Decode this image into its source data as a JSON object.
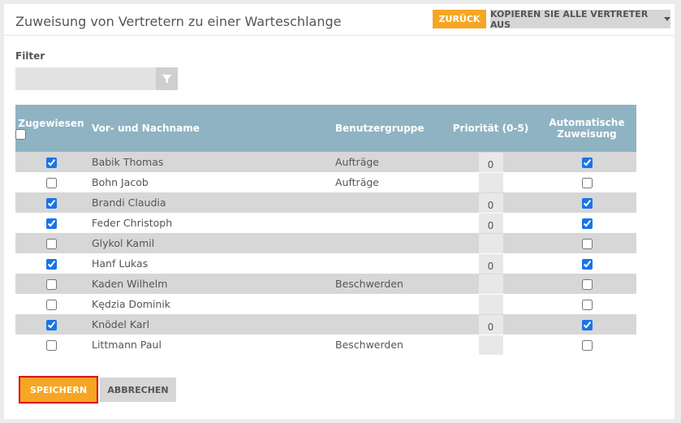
{
  "header": {
    "title": "Zuweisung von Vertretern zu einer Warteschlange",
    "back_label": "ZURÜCK",
    "copy_label": "KOPIEREN SIE ALLE VERTRETER AUS"
  },
  "filter": {
    "label": "Filter",
    "value": "",
    "placeholder": ""
  },
  "table": {
    "columns": [
      "Zugewiesen",
      "Vor- und Nachname",
      "Benutzergruppe",
      "Priorität (0-5)",
      "Automatische Zuweisung"
    ],
    "rows": [
      {
        "assigned": true,
        "name": "Babik Thomas",
        "group": "Aufträge",
        "priority": "0",
        "auto": true
      },
      {
        "assigned": false,
        "name": "Bohn Jacob",
        "group": "Aufträge",
        "priority": "",
        "auto": false
      },
      {
        "assigned": true,
        "name": "Brandi Claudia",
        "group": "",
        "priority": "0",
        "auto": true
      },
      {
        "assigned": true,
        "name": "Feder Christoph",
        "group": "",
        "priority": "0",
        "auto": true
      },
      {
        "assigned": false,
        "name": "Glykol Kamil",
        "group": "",
        "priority": "",
        "auto": false
      },
      {
        "assigned": true,
        "name": "Hanf Lukas",
        "group": "",
        "priority": "0",
        "auto": true
      },
      {
        "assigned": false,
        "name": "Kaden Wilhelm",
        "group": "Beschwerden",
        "priority": "",
        "auto": false
      },
      {
        "assigned": false,
        "name": "Kędzia Dominik",
        "group": "",
        "priority": "",
        "auto": false
      },
      {
        "assigned": true,
        "name": "Knödel Karl",
        "group": "",
        "priority": "0",
        "auto": true
      },
      {
        "assigned": false,
        "name": "Littmann Paul",
        "group": "Beschwerden",
        "priority": "",
        "auto": false
      }
    ]
  },
  "footer": {
    "save_label": "SPEICHERN",
    "cancel_label": "ABBRECHEN"
  },
  "colors": {
    "accent": "#f5a623",
    "header_bg": "#8fb3c3",
    "highlight_border": "#e0001a"
  },
  "icons": {
    "filter": "filter-funnel-icon",
    "dropdown": "caret-down-icon"
  }
}
